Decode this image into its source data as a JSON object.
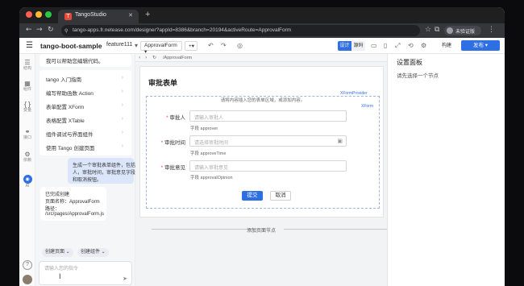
{
  "browser": {
    "tab_title": "TangoStudio",
    "tab_favicon": "T",
    "url": "tango-apps.fr.netease.com/designer?appId=8386&branch=20194&activeRoute=ApprovalForm",
    "profile_label": "未验证版"
  },
  "header": {
    "app_name": "tango-boot-sample",
    "branch": "feature111",
    "route_select": "ApprovalForm",
    "add_label": "+",
    "seg_design": "设计",
    "seg_source": "源码",
    "build_label": "构建",
    "publish_label": "发布",
    "accent": "#2f6fe4"
  },
  "rail": {
    "items": [
      {
        "icon": "outline-icon",
        "glyph": "☰",
        "label": "结构"
      },
      {
        "icon": "components-icon",
        "glyph": "▦",
        "label": "组件"
      },
      {
        "icon": "variables-icon",
        "glyph": "{ }",
        "label": "变量"
      },
      {
        "icon": "link-icon",
        "glyph": "⚭",
        "label": "接口"
      },
      {
        "icon": "dependency-icon",
        "glyph": "⚙",
        "label": "依赖"
      },
      {
        "icon": "ai-assistant-icon",
        "glyph": "◉",
        "label": "AI"
      }
    ],
    "help_glyph": "?"
  },
  "assistant": {
    "intro_partial": "我可以帮助您编辑代码。",
    "menu": [
      "tango 入门指南",
      "编写帮助函数 Action",
      "表单配置 XForm",
      "表格配置 XTable",
      "组件调试与界面组件",
      "使用 Tango 创建页面"
    ],
    "user_message": [
      "生成一个审批表单组件，包括审批",
      "人，审批时间，审批意见字段，提交",
      "和取消按钮。"
    ],
    "ai_reply": [
      "已完成创建",
      "页面名称：ApprovalForm",
      "路径：",
      "/src/pages/ApprovalForm.js"
    ],
    "chips": [
      "创建页面",
      "创建组件"
    ],
    "input_placeholder": "请输入您的指令"
  },
  "canvas": {
    "path": "/ApprovalForm",
    "page_title": "审批表单",
    "hint": "请将内容插入您的表单区域，或添加内容。",
    "outer_tag": "XFormProvider",
    "inner_tag": "XForm",
    "fields": [
      {
        "label": "审批人",
        "placeholder": "请输入审批人",
        "name": "字段 approver",
        "calendar": false
      },
      {
        "label": "审批时间",
        "placeholder": "请选择审批时间",
        "name": "字段 approveTime",
        "calendar": true
      },
      {
        "label": "审批意见",
        "placeholder": "请输入审批意见",
        "name": "字段 approvalOpinion",
        "calendar": false
      }
    ],
    "submit_label": "提交",
    "cancel_label": "取消",
    "add_node": "添加页面节点"
  },
  "settings": {
    "title": "设置面板",
    "subtitle": "请先选择一个节点"
  }
}
